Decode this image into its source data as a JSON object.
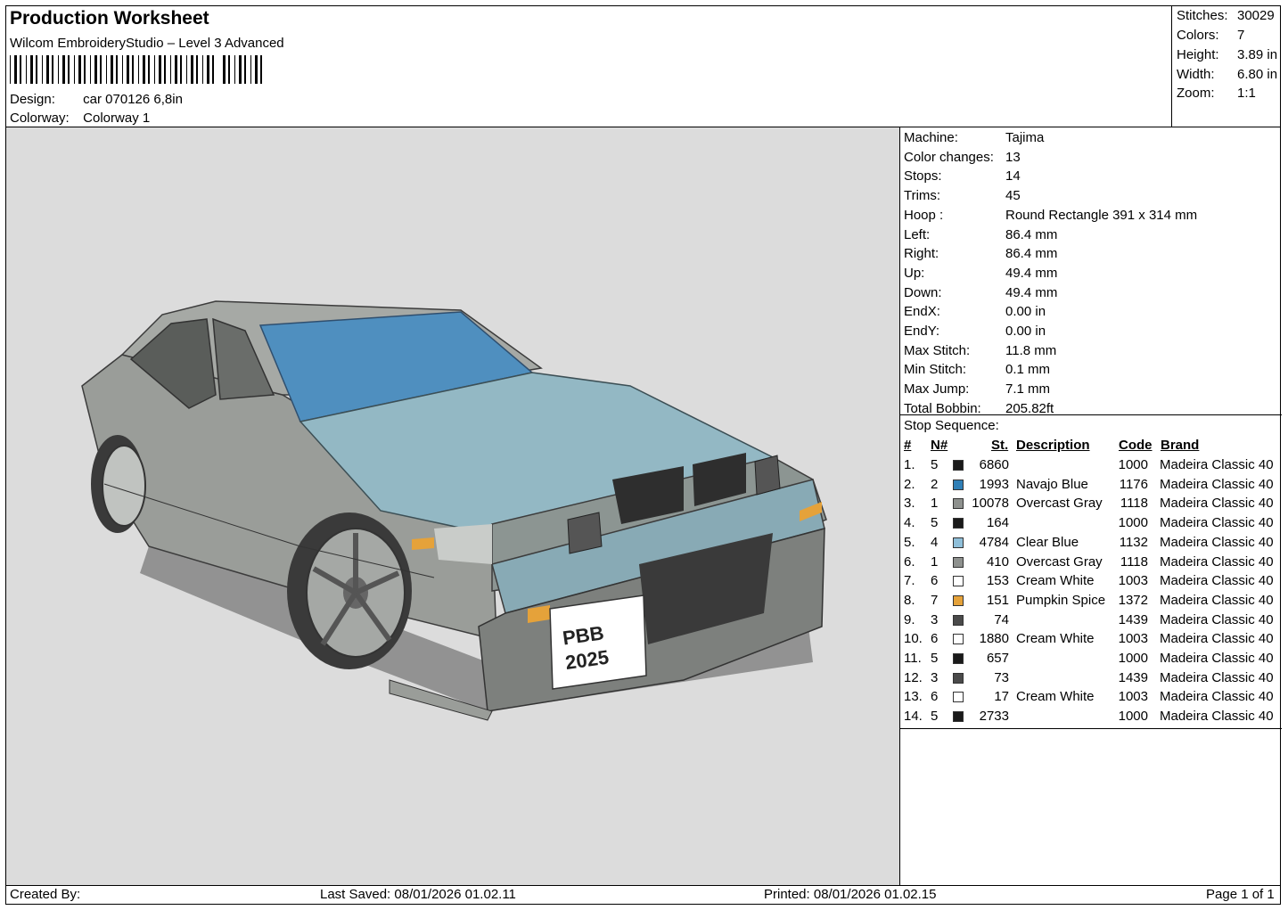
{
  "header": {
    "title": "Production Worksheet",
    "software": "Wilcom EmbroideryStudio – Level 3 Advanced",
    "design_label": "Design:",
    "design_value": "car 070126 6,8in",
    "colorway_label": "Colorway:",
    "colorway_value": "Colorway 1"
  },
  "stats": [
    {
      "label": "Stitches:",
      "value": "30029"
    },
    {
      "label": "Colors:",
      "value": "7"
    },
    {
      "label": "Height:",
      "value": "3.89 in"
    },
    {
      "label": "Width:",
      "value": "6.80 in"
    },
    {
      "label": "Zoom:",
      "value": "1:1"
    }
  ],
  "machine_info": [
    {
      "label": "Machine:",
      "value": "Tajima"
    },
    {
      "label": "Color changes:",
      "value": "13"
    },
    {
      "label": "Stops:",
      "value": "14"
    },
    {
      "label": "Trims:",
      "value": "45"
    },
    {
      "label": "Hoop :",
      "value": "Round Rectangle 391 x 314 mm"
    },
    {
      "label": "Left:",
      "value": "86.4 mm"
    },
    {
      "label": "Right:",
      "value": "86.4 mm"
    },
    {
      "label": "Up:",
      "value": "49.4 mm"
    },
    {
      "label": "Down:",
      "value": "49.4 mm"
    },
    {
      "label": "EndX:",
      "value": "0.00 in"
    },
    {
      "label": "EndY:",
      "value": "0.00 in"
    },
    {
      "label": "Max Stitch:",
      "value": "11.8 mm"
    },
    {
      "label": "Min Stitch:",
      "value": "0.1 mm"
    },
    {
      "label": "Max Jump:",
      "value": "7.1 mm"
    },
    {
      "label": "Total Bobbin:",
      "value": "205.82ft"
    }
  ],
  "stop_sequence": {
    "title": "Stop Sequence:",
    "columns": {
      "num": "#",
      "needle": "N#",
      "stitches": "St.",
      "description": "Description",
      "code": "Code",
      "brand": "Brand"
    },
    "rows": [
      {
        "num": "1.",
        "needle": "5",
        "color": "#1a1a1a",
        "stitches": "6860",
        "description": "",
        "code": "1000",
        "brand": "Madeira Classic 40"
      },
      {
        "num": "2.",
        "needle": "2",
        "color": "#2f7fb6",
        "stitches": "1993",
        "description": "Navajo Blue",
        "code": "1176",
        "brand": "Madeira Classic 40"
      },
      {
        "num": "3.",
        "needle": "1",
        "color": "#8e918e",
        "stitches": "10078",
        "description": "Overcast Gray",
        "code": "1118",
        "brand": "Madeira Classic 40"
      },
      {
        "num": "4.",
        "needle": "5",
        "color": "#1a1a1a",
        "stitches": "164",
        "description": "",
        "code": "1000",
        "brand": "Madeira Classic 40"
      },
      {
        "num": "5.",
        "needle": "4",
        "color": "#8fbfd9",
        "stitches": "4784",
        "description": "Clear Blue",
        "code": "1132",
        "brand": "Madeira Classic 40"
      },
      {
        "num": "6.",
        "needle": "1",
        "color": "#8e918e",
        "stitches": "410",
        "description": "Overcast Gray",
        "code": "1118",
        "brand": "Madeira Classic 40"
      },
      {
        "num": "7.",
        "needle": "6",
        "color": "#ffffff",
        "stitches": "153",
        "description": "Cream White",
        "code": "1003",
        "brand": "Madeira Classic 40"
      },
      {
        "num": "8.",
        "needle": "7",
        "color": "#e5a23a",
        "stitches": "151",
        "description": "Pumpkin Spice",
        "code": "1372",
        "brand": "Madeira Classic 40"
      },
      {
        "num": "9.",
        "needle": "3",
        "color": "#4a4a4a",
        "stitches": "74",
        "description": "",
        "code": "1439",
        "brand": "Madeira Classic 40"
      },
      {
        "num": "10.",
        "needle": "6",
        "color": "#ffffff",
        "stitches": "1880",
        "description": "Cream White",
        "code": "1003",
        "brand": "Madeira Classic 40"
      },
      {
        "num": "11.",
        "needle": "5",
        "color": "#1a1a1a",
        "stitches": "657",
        "description": "",
        "code": "1000",
        "brand": "Madeira Classic 40"
      },
      {
        "num": "12.",
        "needle": "3",
        "color": "#4a4a4a",
        "stitches": "73",
        "description": "",
        "code": "1439",
        "brand": "Madeira Classic 40"
      },
      {
        "num": "13.",
        "needle": "6",
        "color": "#ffffff",
        "stitches": "17",
        "description": "Cream White",
        "code": "1003",
        "brand": "Madeira Classic 40"
      },
      {
        "num": "14.",
        "needle": "5",
        "color": "#1a1a1a",
        "stitches": "2733",
        "description": "",
        "code": "1000",
        "brand": "Madeira Classic 40"
      }
    ]
  },
  "plate": {
    "line1": "PBB",
    "line2": "2025"
  },
  "footer": {
    "created_by": "Created By:",
    "last_saved": "Last Saved: 08/01/2026 01.02.11",
    "printed": "Printed: 08/01/2026 01.02.15",
    "page": "Page 1 of 1"
  },
  "colors": {
    "canvas": "#dcdcdc",
    "car_body": "#9a9d99",
    "hood": "#93b8c4",
    "windshield": "#4f8fbf"
  }
}
